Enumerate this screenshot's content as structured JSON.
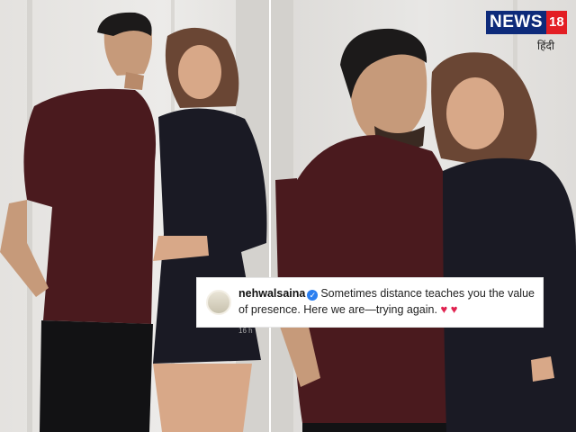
{
  "logo": {
    "brand": "NEWS",
    "number": "18",
    "language": "हिंदी"
  },
  "caption": {
    "username": "nehwalsaina",
    "text": "Sometimes distance teaches you the value of presence. Here we are—trying again.",
    "hearts": "♥ ♥",
    "time": "16 h"
  },
  "colors": {
    "brand_blue": "#0d2a7a",
    "brand_red": "#e31e24",
    "shirt": "#4a1a1e",
    "dress": "#1a1a24"
  }
}
